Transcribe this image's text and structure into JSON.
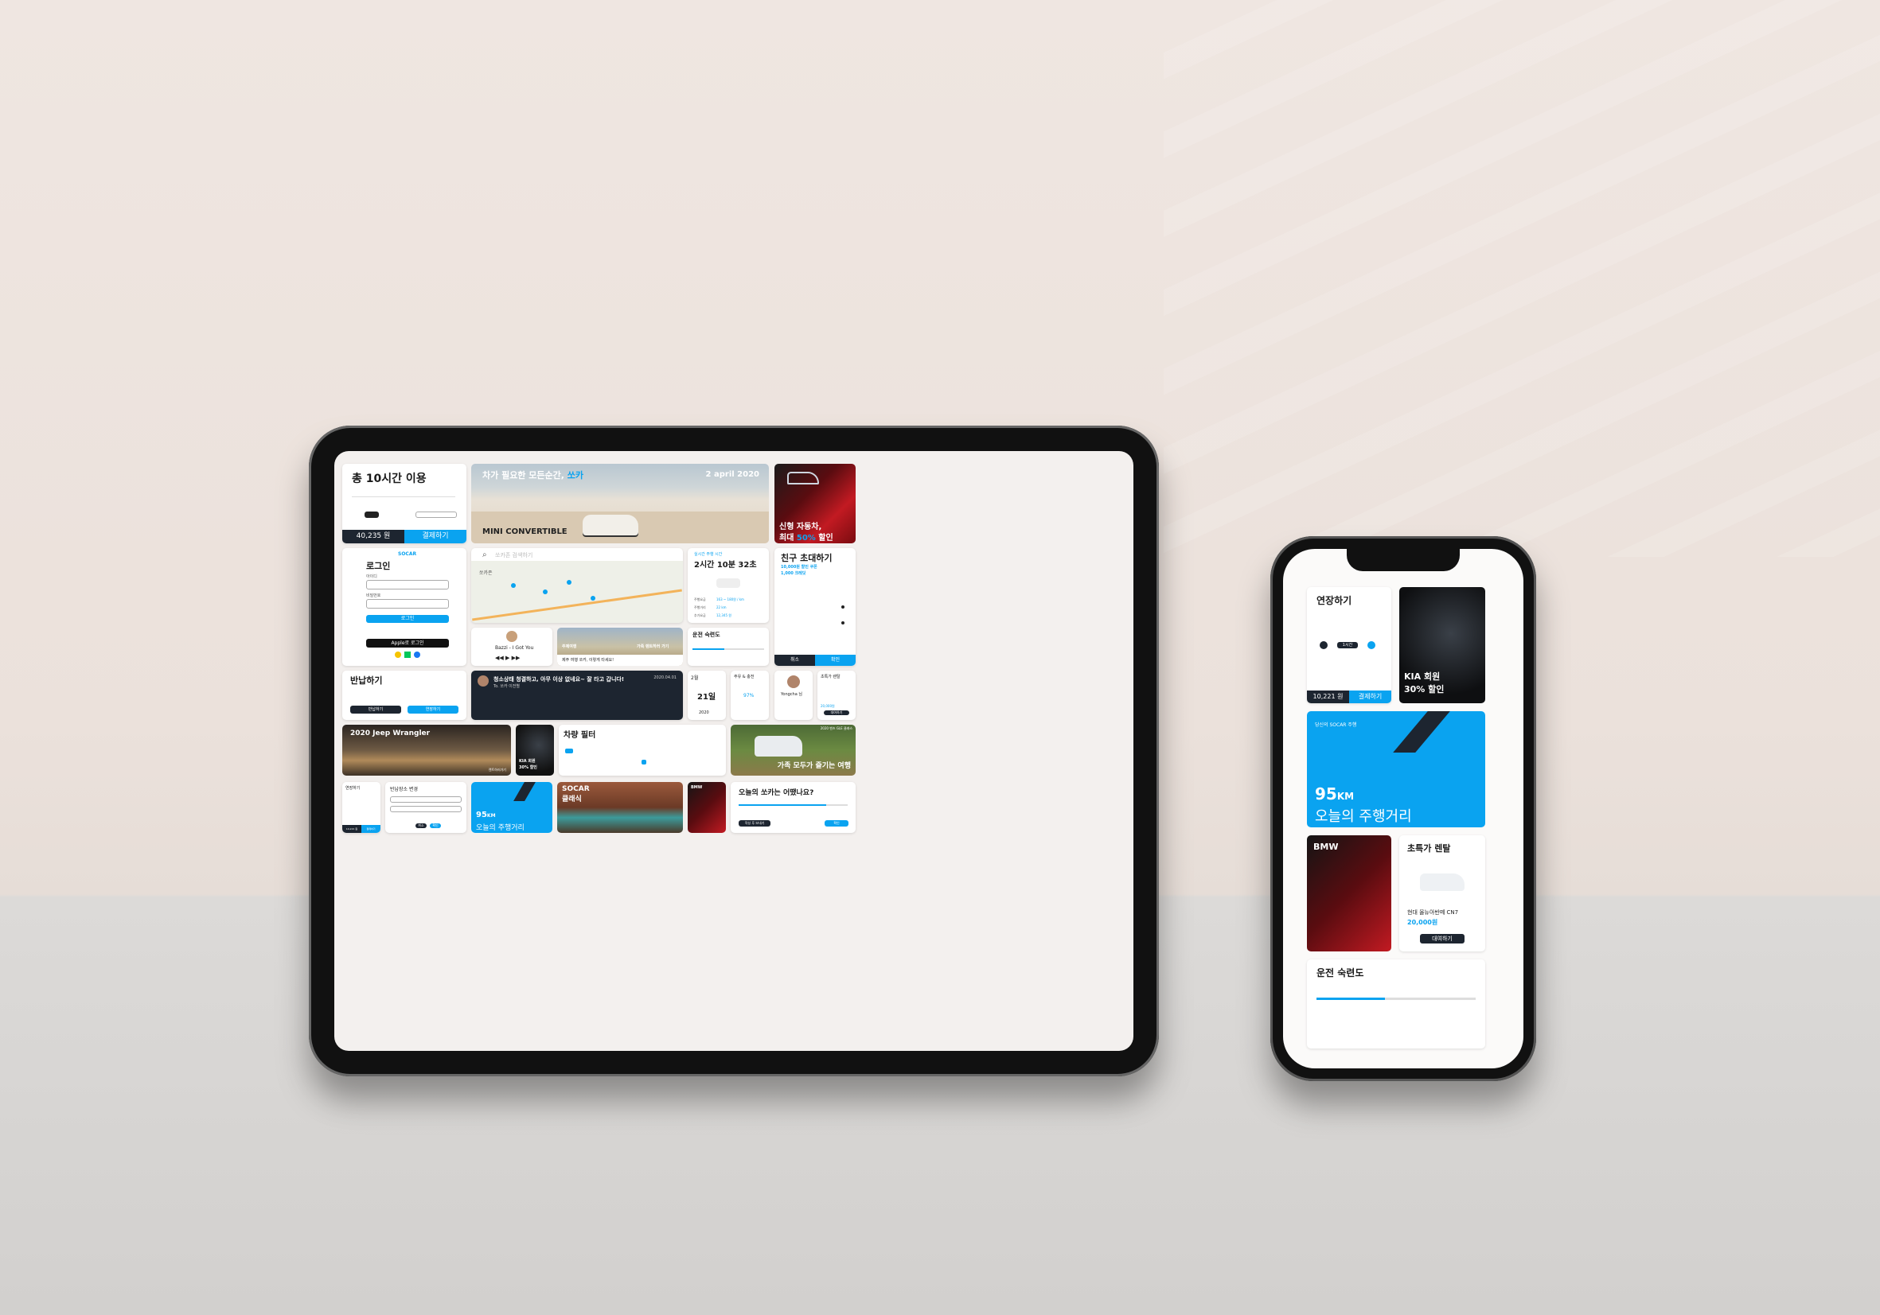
{
  "tablet": {
    "usage": {
      "title": "총 10시간 이용",
      "price": "40,235 원",
      "pay": "결제하기"
    },
    "hero": {
      "headline_a": "차가 필요한 모든순간, ",
      "headline_b": "쏘카",
      "date": "2 april 2020",
      "car": "MINI CONVERTIBLE"
    },
    "promo": {
      "line1": "신형 자동차,",
      "line2a": "최대 ",
      "line2b": "50%",
      "line2c": " 할인"
    },
    "login": {
      "brand": "SOCAR",
      "title": "로그인",
      "id_label": "아이디",
      "pw_label": "비밀번호",
      "login_btn": "로그인",
      "apple_btn": "Apple로 로그인"
    },
    "search": {
      "placeholder": "쏘카존 검색하기",
      "zone": "쏘카존"
    },
    "time": {
      "label": "실시간 주행 시간",
      "value": "2시간 10분 32초",
      "r1a": "주행요금",
      "r1b": "163 ~ 180원 / km",
      "r2a": "주행거리",
      "r2b": "22 km",
      "r3a": "추가요금",
      "r3b": "12,345 원"
    },
    "invite": {
      "title": "친구 초대하기",
      "sub1": "10,000원 할인 쿠폰",
      "sub2": "1,000 크레딧",
      "cancel": "취소",
      "ok": "확인"
    },
    "music": {
      "song": "Bazzi - I Got You"
    },
    "trip": {
      "tag": "주제여행",
      "tag2": "가족 렌트하러 가기",
      "caption": "제주 여행 쏘카, 이렇게 타세요!"
    },
    "skill": {
      "title": "운전 숙련도"
    },
    "return": {
      "title": "반납하기",
      "b1": "반납하기",
      "b2": "연장하기"
    },
    "message": {
      "title": "청소상태 청결하고, 아무 이상 없네요~ 잘 타고 갑니다!",
      "to": "To. 쏘카 이전별",
      "date": "2020.04.01"
    },
    "cal": {
      "month": "2월",
      "day": "21일",
      "year": "2020"
    },
    "fuel": {
      "title": "주유 & 충전",
      "pct": "97%"
    },
    "user": {
      "name": "Yongcha 님"
    },
    "special": {
      "title": "초특가 렌탈",
      "price": "20,000원",
      "btn": "대여하기"
    },
    "jeep": {
      "title": "2020 Jeep Wrangler",
      "link": "렌트하러가기"
    },
    "kia": {
      "l1": "KIA 회원",
      "l2": "30% 할인"
    },
    "filter": {
      "title": "차량 필터"
    },
    "family": {
      "title": "가족 모두가 즐기는 여행",
      "tag": "2020 벤츠 GLE 클래스"
    },
    "extend": {
      "title": "연장하기",
      "price": "10,221 원",
      "pay": "결제하기"
    },
    "location": {
      "title": "반납장소 변경",
      "cancel": "취소",
      "ok": "확인"
    },
    "distance": {
      "num": "95",
      "unit": "KM",
      "label": "오늘의 주행거리"
    },
    "classic": {
      "l1": "SOCAR",
      "l2": "클래식"
    },
    "bmw": {
      "label": "BMW"
    },
    "survey": {
      "title": "오늘의 쏘카는 어땠나요?",
      "b1": "작성 후 보내기",
      "b2": "확인"
    }
  },
  "phone": {
    "extend": {
      "title": "연장하기",
      "price": "10,221 원",
      "pay": "결제하기",
      "time": "1시간"
    },
    "kia": {
      "l1": "KIA 회원",
      "l2": "30% 할인"
    },
    "distance": {
      "num": "95",
      "unit": "KM",
      "label": "오늘의 주행거리",
      "small": "당신의 SOCAR 주행"
    },
    "bmw": {
      "label": "BMW"
    },
    "special": {
      "title": "초특가 렌탈",
      "car": "현대 올뉴아반떼 CN7",
      "price": "20,000원",
      "btn": "대여하기"
    },
    "skill": {
      "title": "운전 숙련도"
    }
  },
  "colors": {
    "accent": "#0aa3f0",
    "dark": "#1d2530"
  }
}
